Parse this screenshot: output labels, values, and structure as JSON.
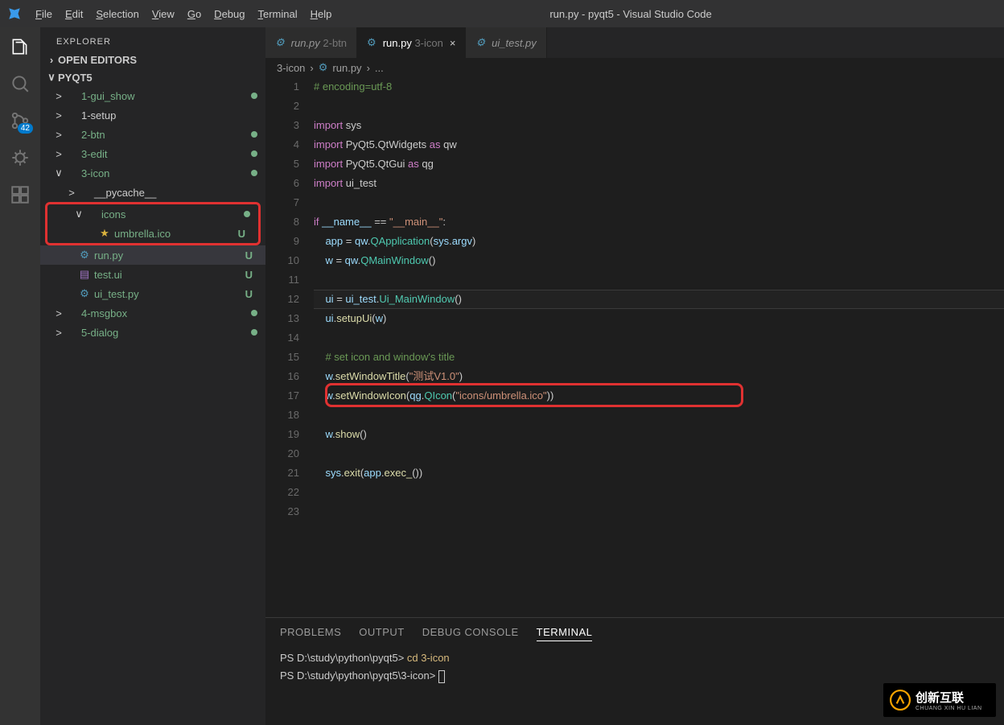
{
  "window": {
    "title": "run.py - pyqt5 - Visual Studio Code"
  },
  "menu": [
    "File",
    "Edit",
    "Selection",
    "View",
    "Go",
    "Debug",
    "Terminal",
    "Help"
  ],
  "activity": {
    "scm_badge": "42"
  },
  "sidebar": {
    "title": "EXPLORER",
    "open_editors": "OPEN EDITORS",
    "project": "PYQT5",
    "items": [
      {
        "indent": 1,
        "arr": ">",
        "icon": "",
        "label": "1-gui_show",
        "green": true,
        "dot": true
      },
      {
        "indent": 1,
        "arr": ">",
        "icon": "",
        "label": "1-setup"
      },
      {
        "indent": 1,
        "arr": ">",
        "icon": "",
        "label": "2-btn",
        "green": true,
        "dot": true
      },
      {
        "indent": 1,
        "arr": ">",
        "icon": "",
        "label": "3-edit",
        "green": true,
        "dot": true
      },
      {
        "indent": 1,
        "arr": "∨",
        "icon": "",
        "label": "3-icon",
        "green": true,
        "dot": true
      },
      {
        "indent": 2,
        "arr": ">",
        "icon": "",
        "label": "__pycache__"
      },
      {
        "indent": 2,
        "arr": "∨",
        "icon": "",
        "label": "icons",
        "green": true,
        "dot": true,
        "redbox": "top"
      },
      {
        "indent": 3,
        "arr": "",
        "icon": "star",
        "label": "umbrella.ico",
        "green": true,
        "u": true,
        "redbox": "bot"
      },
      {
        "indent": 2,
        "arr": "",
        "icon": "py",
        "label": "run.py",
        "green": true,
        "u": true,
        "selected": true
      },
      {
        "indent": 2,
        "arr": "",
        "icon": "ui",
        "label": "test.ui",
        "green": true,
        "u": true
      },
      {
        "indent": 2,
        "arr": "",
        "icon": "py",
        "label": "ui_test.py",
        "green": true,
        "u": true
      },
      {
        "indent": 1,
        "arr": ">",
        "icon": "",
        "label": "4-msgbox",
        "green": true,
        "dot": true
      },
      {
        "indent": 1,
        "arr": ">",
        "icon": "",
        "label": "5-dialog",
        "green": true,
        "dot": true
      }
    ]
  },
  "tabs": [
    {
      "icon": "py",
      "file": "run.py",
      "dim": "2-btn",
      "active": false,
      "close": false
    },
    {
      "icon": "py",
      "file": "run.py",
      "dim": "3-icon",
      "active": true,
      "close": true
    },
    {
      "icon": "py",
      "file": "ui_test.py",
      "dim": "",
      "active": false,
      "close": false
    }
  ],
  "breadcrumb": {
    "folder": "3-icon",
    "file": "run.py",
    "rest": "..."
  },
  "code": {
    "lines": [
      {
        "n": 1,
        "t": "comment",
        "text": "# encoding=utf-8"
      },
      {
        "n": 2,
        "t": "blank",
        "text": ""
      },
      {
        "n": 3,
        "t": "import",
        "kw": "import",
        "rest": " sys"
      },
      {
        "n": 4,
        "t": "import_as",
        "kw": "import",
        "mod": " PyQt5.QtWidgets ",
        "as": "as",
        "alias": " qw"
      },
      {
        "n": 5,
        "t": "import_as",
        "kw": "import",
        "mod": " PyQt5.QtGui ",
        "as": "as",
        "alias": " qg"
      },
      {
        "n": 6,
        "t": "import",
        "kw": "import",
        "rest": " ui_test"
      },
      {
        "n": 7,
        "t": "blank",
        "text": ""
      },
      {
        "n": 8,
        "t": "if",
        "text": "if __name__ == \"__main__\":"
      },
      {
        "n": 9,
        "t": "raw",
        "text": "    app = qw.QApplication(sys.argv)"
      },
      {
        "n": 10,
        "t": "raw",
        "text": "    w = qw.QMainWindow()"
      },
      {
        "n": 11,
        "t": "blank",
        "text": ""
      },
      {
        "n": 12,
        "t": "raw",
        "text": "    ui = ui_test.Ui_MainWindow()",
        "cursor": true
      },
      {
        "n": 13,
        "t": "raw",
        "text": "    ui.setupUi(w)"
      },
      {
        "n": 14,
        "t": "blank",
        "text": ""
      },
      {
        "n": 15,
        "t": "comment",
        "text": "    # set icon and window's title"
      },
      {
        "n": 16,
        "t": "raw",
        "text": "    w.setWindowTitle(\"测试V1.0\")"
      },
      {
        "n": 17,
        "t": "raw",
        "text": "    w.setWindowIcon(qg.QIcon(\"icons/umbrella.ico\"))",
        "redbox": true
      },
      {
        "n": 18,
        "t": "blank",
        "text": ""
      },
      {
        "n": 19,
        "t": "raw",
        "text": "    w.show()"
      },
      {
        "n": 20,
        "t": "blank",
        "text": ""
      },
      {
        "n": 21,
        "t": "raw",
        "text": "    sys.exit(app.exec_())"
      },
      {
        "n": 22,
        "t": "blank",
        "text": ""
      },
      {
        "n": 23,
        "t": "blank",
        "text": ""
      }
    ]
  },
  "panel": {
    "tabs": [
      "PROBLEMS",
      "OUTPUT",
      "DEBUG CONSOLE",
      "TERMINAL"
    ],
    "active": "TERMINAL",
    "lines": [
      {
        "prompt": "PS D:\\study\\python\\pyqt5> ",
        "cmd": "cd 3-icon"
      },
      {
        "prompt": "PS D:\\study\\python\\pyqt5\\3-icon> ",
        "cmd": ""
      }
    ]
  },
  "watermark": {
    "brand": "创新互联",
    "sub": "CHUANG XIN HU LIAN"
  }
}
